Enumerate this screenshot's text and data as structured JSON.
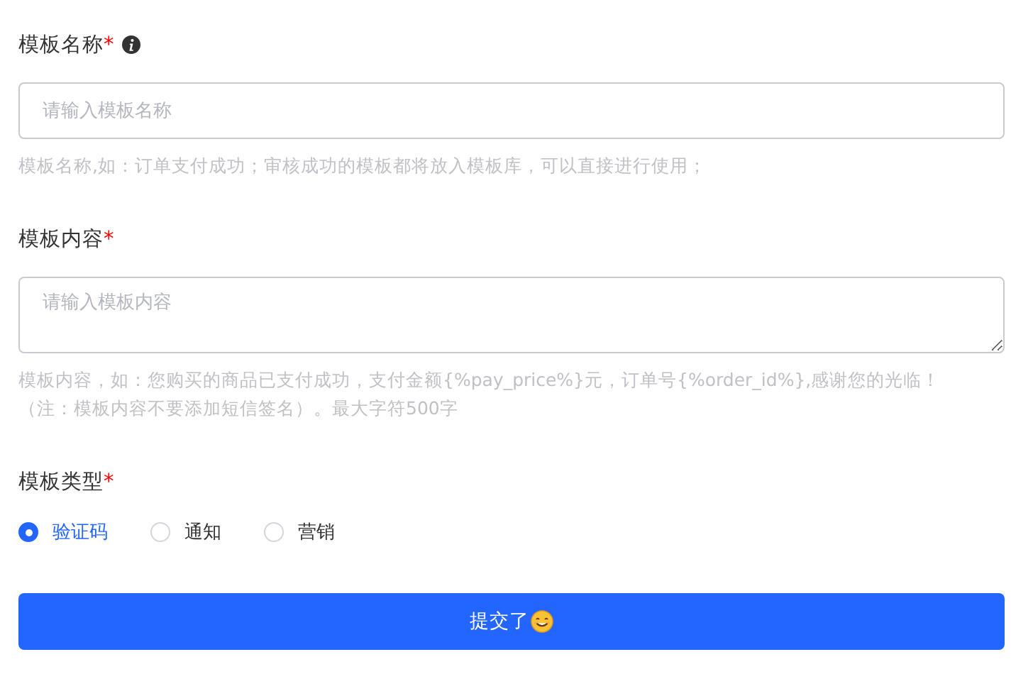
{
  "fields": [
    {
      "kind": "input",
      "label": "模板名称",
      "required_mark": "*",
      "info": true,
      "placeholder": "请输入模板名称",
      "help": [
        "模板名称,如：订单支付成功；审核成功的模板都将放入模板库，可以直接进行使用；"
      ]
    },
    {
      "kind": "textarea",
      "label": "模板内容",
      "required_mark": "*",
      "info": false,
      "placeholder": "请输入模板内容",
      "help": [
        "模板内容，如：您购买的商品已支付成功，支付金额{%pay_price%}元，订单号{%order_id%},感谢您的光临！",
        "（注：模板内容不要添加短信签名）。最大字符500字"
      ]
    },
    {
      "kind": "radio",
      "label": "模板类型",
      "required_mark": "*",
      "info": false,
      "options": [
        {
          "label": "验证码",
          "selected": true
        },
        {
          "label": "通知",
          "selected": false
        },
        {
          "label": "营销",
          "selected": false
        }
      ]
    }
  ],
  "submit": {
    "label": "提交了",
    "emoji": true
  }
}
